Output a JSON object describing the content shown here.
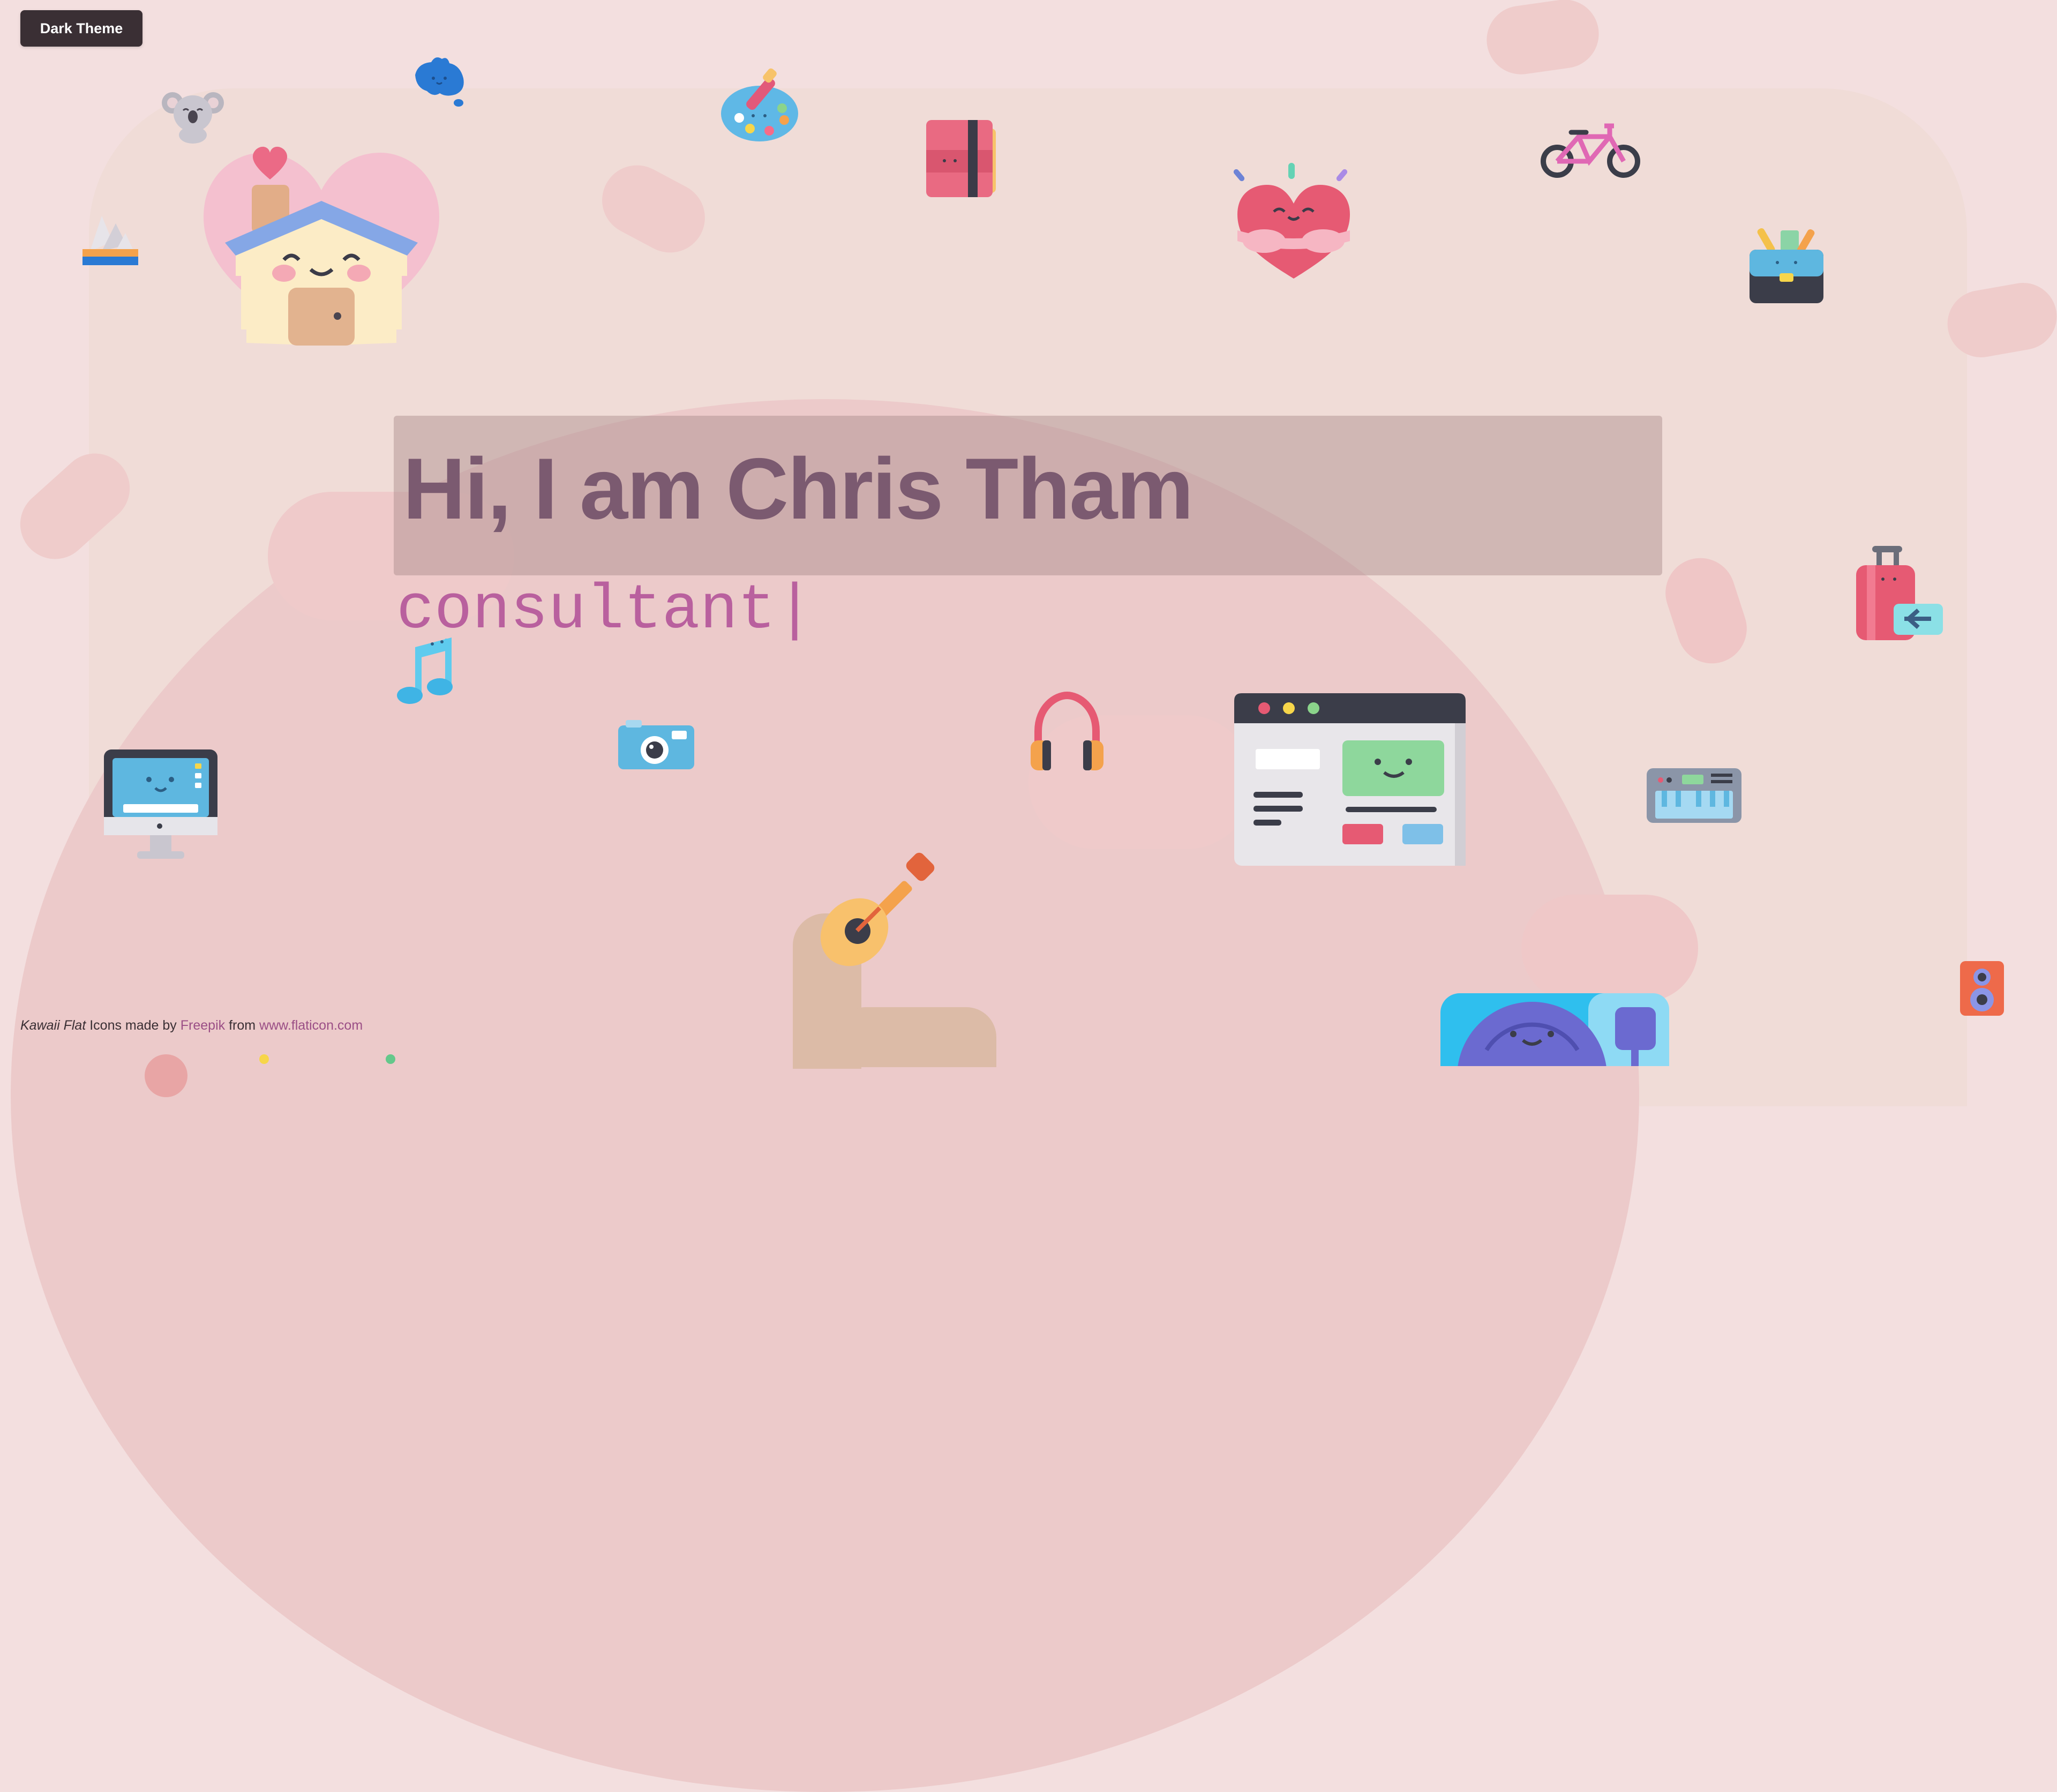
{
  "theme_toggle": {
    "label": "Dark Theme"
  },
  "hero": {
    "heading": "Hi, I am Chris Tham",
    "typed_text": "consultant|"
  },
  "credits": {
    "brand": "Kawaii Flat",
    "icons_made_by": "Icons made by",
    "author": "Freepik",
    "from": "from",
    "site": "www.flaticon.com"
  },
  "colors": {
    "background": "#f3dfdf",
    "heading": "#7b5a70",
    "typed": "#b9609e",
    "button_bg": "#3a2f34",
    "link": "#9b4f86"
  },
  "icons": [
    "koala-icon",
    "australia-map-icon",
    "palette-icon",
    "book-icon",
    "bicycle-icon",
    "opera-house-icon",
    "heart-house-icon",
    "hugging-heart-icon",
    "briefcase-icon",
    "music-note-icon",
    "camera-icon",
    "headphones-icon",
    "browser-window-icon",
    "suitcase-icon",
    "computer-icon",
    "guitar-icon",
    "keyboard-icon",
    "speaker-icon",
    "vinyl-icon"
  ]
}
